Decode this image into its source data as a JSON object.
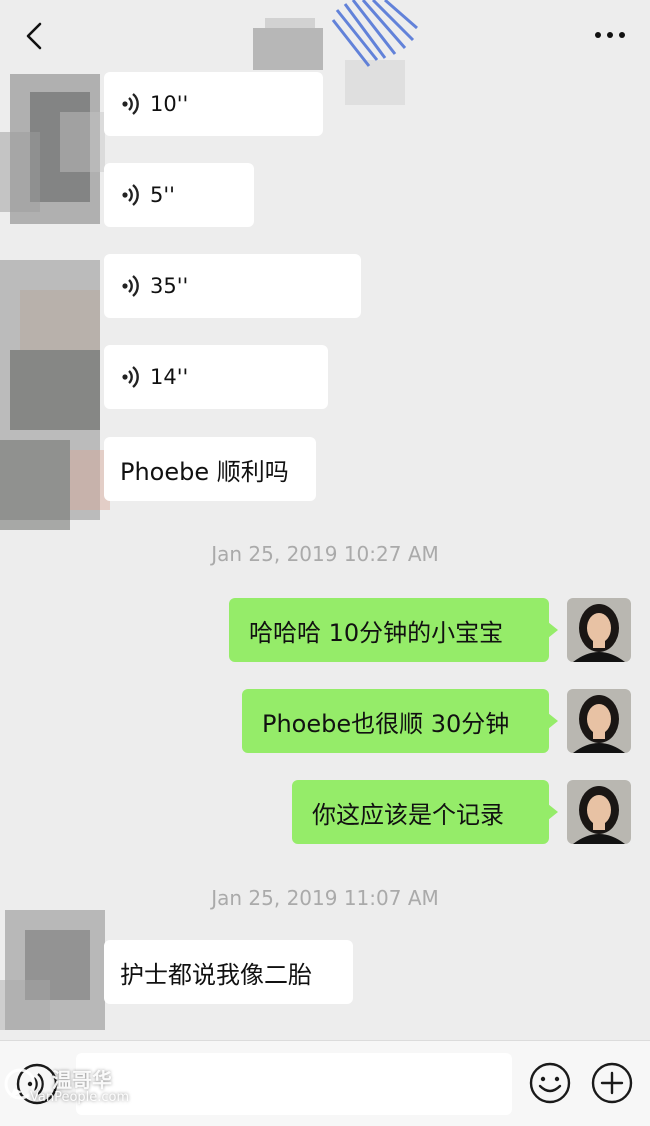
{
  "header": {
    "back_icon": "chevron-left-icon",
    "more_icon": "more-horizontal-icon"
  },
  "messages_group1": {
    "voice_1": "10''",
    "voice_2": "5''",
    "voice_3": "35''",
    "voice_4": "14''",
    "text_1": "Phoebe 顺利吗"
  },
  "timestamp_1": "Jan 25, 2019 10:27 AM",
  "messages_group2": {
    "out_1": "哈哈哈 10分钟的小宝宝",
    "out_2": "Phoebe也很顺 30分钟",
    "out_3": "你这应该是个记录"
  },
  "timestamp_2": "Jan 25, 2019 11:07 AM",
  "messages_group3": {
    "text_1": "护士都说我像二胎"
  },
  "input_bar": {
    "voice_icon": "voice-input-icon",
    "emoji_icon": "emoji-icon",
    "plus_icon": "plus-icon"
  },
  "watermark": {
    "text": "温哥华",
    "url": "VanPeople.com"
  },
  "colors": {
    "background": "#ededed",
    "incoming_bubble": "#ffffff",
    "outgoing_bubble": "#95ec69",
    "timestamp": "#aaaaaa"
  }
}
